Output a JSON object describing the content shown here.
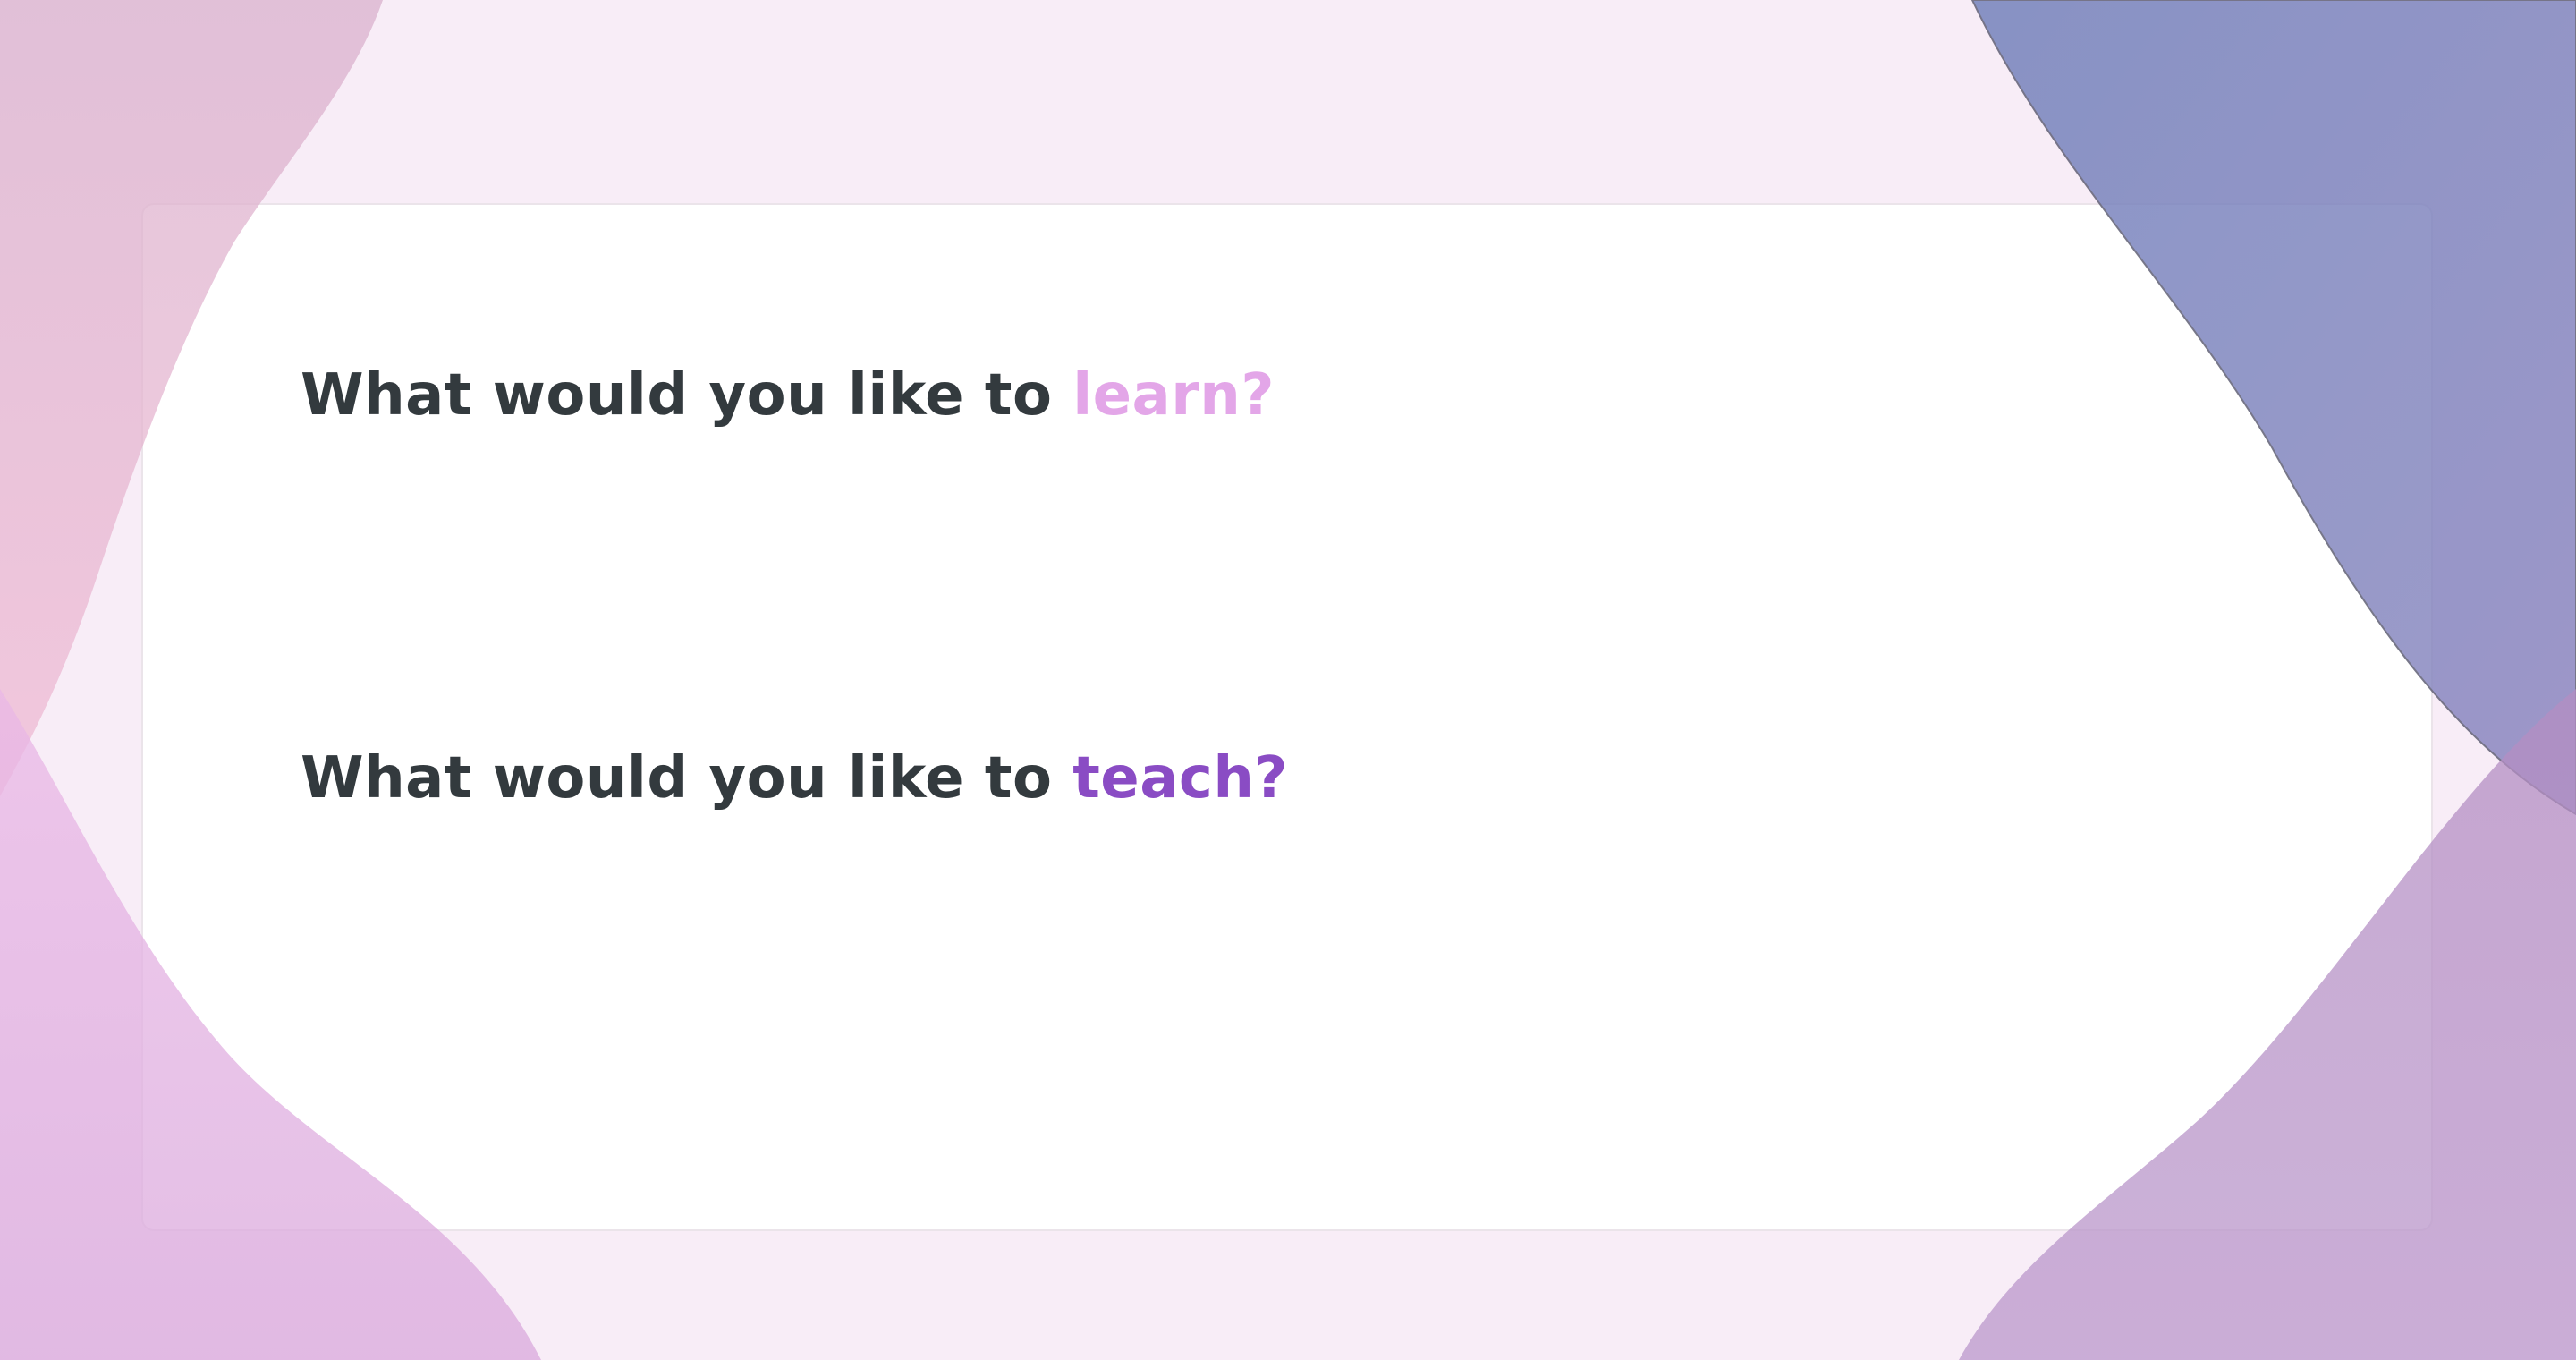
{
  "questions": {
    "learn": {
      "prefix": "What would you like to",
      "accent": "learn?"
    },
    "teach": {
      "prefix": "What would you like to",
      "accent": "teach?"
    }
  },
  "colors": {
    "background": "#f8edf7",
    "card": "#ffffff",
    "heading_text": "#333a3e",
    "accent_learn": "#e3a6e8",
    "accent_teach": "#8a4cc4",
    "blob_top_left": "#dcb1cf",
    "blob_bottom_left": "#e3b2e2",
    "blob_top_right": "#7a88bb",
    "blob_bottom_right": "#b896c8"
  }
}
